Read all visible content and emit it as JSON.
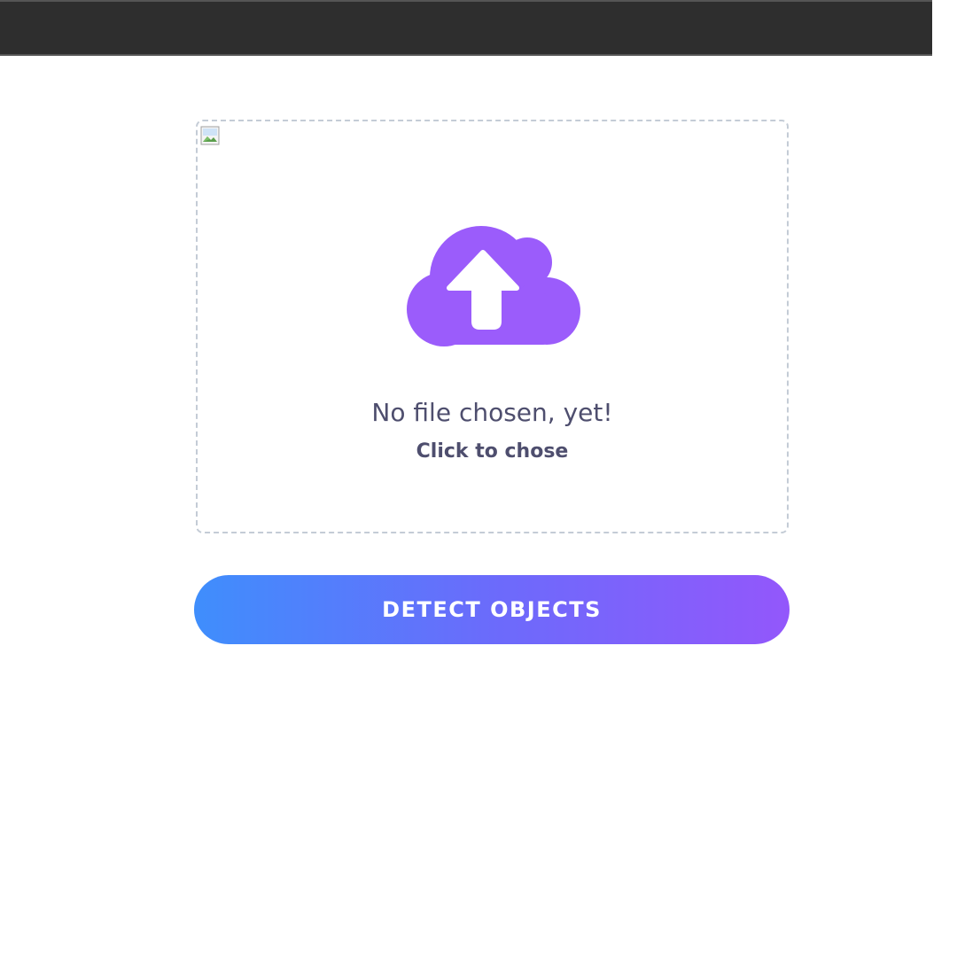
{
  "upload": {
    "status_text": "No file chosen, yet!",
    "hint_text": "Click to chose",
    "icon": "cloud-upload-icon",
    "icon_color": "#9b5cfb",
    "border_color": "#c4ccd6"
  },
  "action": {
    "detect_label": "DETECT OBJECTS",
    "gradient_start": "#3f8efc",
    "gradient_end": "#9357fb"
  },
  "colors": {
    "top_bar": "#2e2e2e",
    "text": "#4e4e6e"
  }
}
